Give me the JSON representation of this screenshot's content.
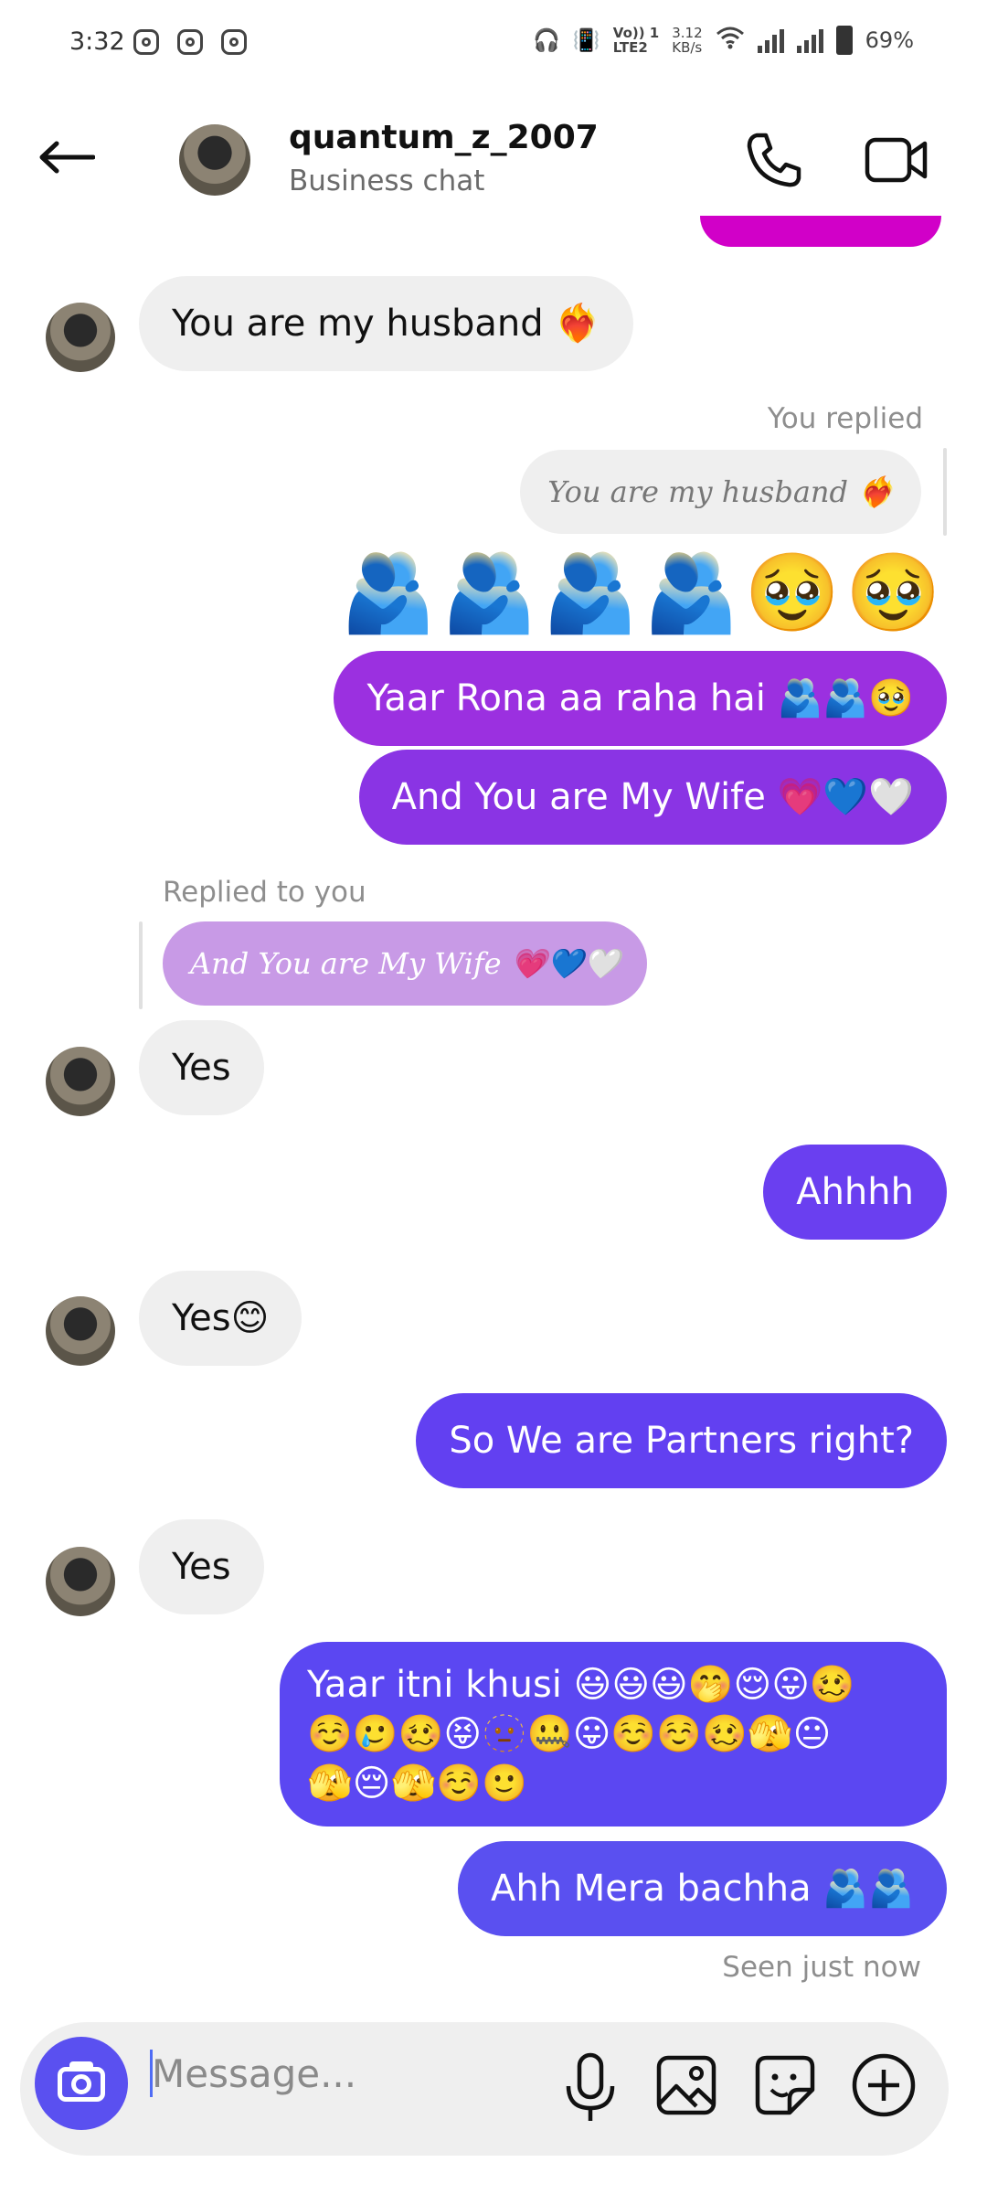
{
  "status_bar": {
    "time": "3:32",
    "net_top": "Vo)) 1",
    "net_bottom": "LTE2",
    "speed_top": "3.12",
    "speed_bottom": "KB/s",
    "battery": "69%"
  },
  "header": {
    "username": "quantum_z_2007",
    "subtitle": "Business chat"
  },
  "messages": {
    "m1": "You are my husband ❤️‍🔥",
    "you_replied_label": "You replied",
    "reply_quote_1": "You are my husband ❤️‍🔥",
    "emoji_row": "🫂🫂🫂🫂🥹🥹",
    "m2": "Yaar Rona aa raha hai 🫂🫂🥹",
    "m3": "And You are My Wife 💗💙🤍",
    "replied_to_you_label": "Replied to you",
    "reply_quote_2": "And You are My Wife 💗💙🤍",
    "m4": "Yes",
    "m5": "Ahhhh",
    "m6": "Yes😊",
    "m7": "So We are Partners right?",
    "m8": "Yes",
    "m9_line1": "Yaar itni khusi 😃😃😃🤭😌😛🥴",
    "m9_line2": "☺️🥲🥴😝🫥🤐😛☺️☺️🥴🫣😐",
    "m9_line3": "🫣😔🫣☺️🙂",
    "m10": "Ahh Mera bachha 🫂🫂",
    "seen": "Seen just now"
  },
  "composer": {
    "placeholder": "Message..."
  },
  "colors": {
    "accent": "#5a50f0",
    "purple_top": "#9b30e0",
    "purple_mid": "#8a34e4",
    "indigo": "#6a3ff0",
    "incoming_bg": "#efefef"
  }
}
